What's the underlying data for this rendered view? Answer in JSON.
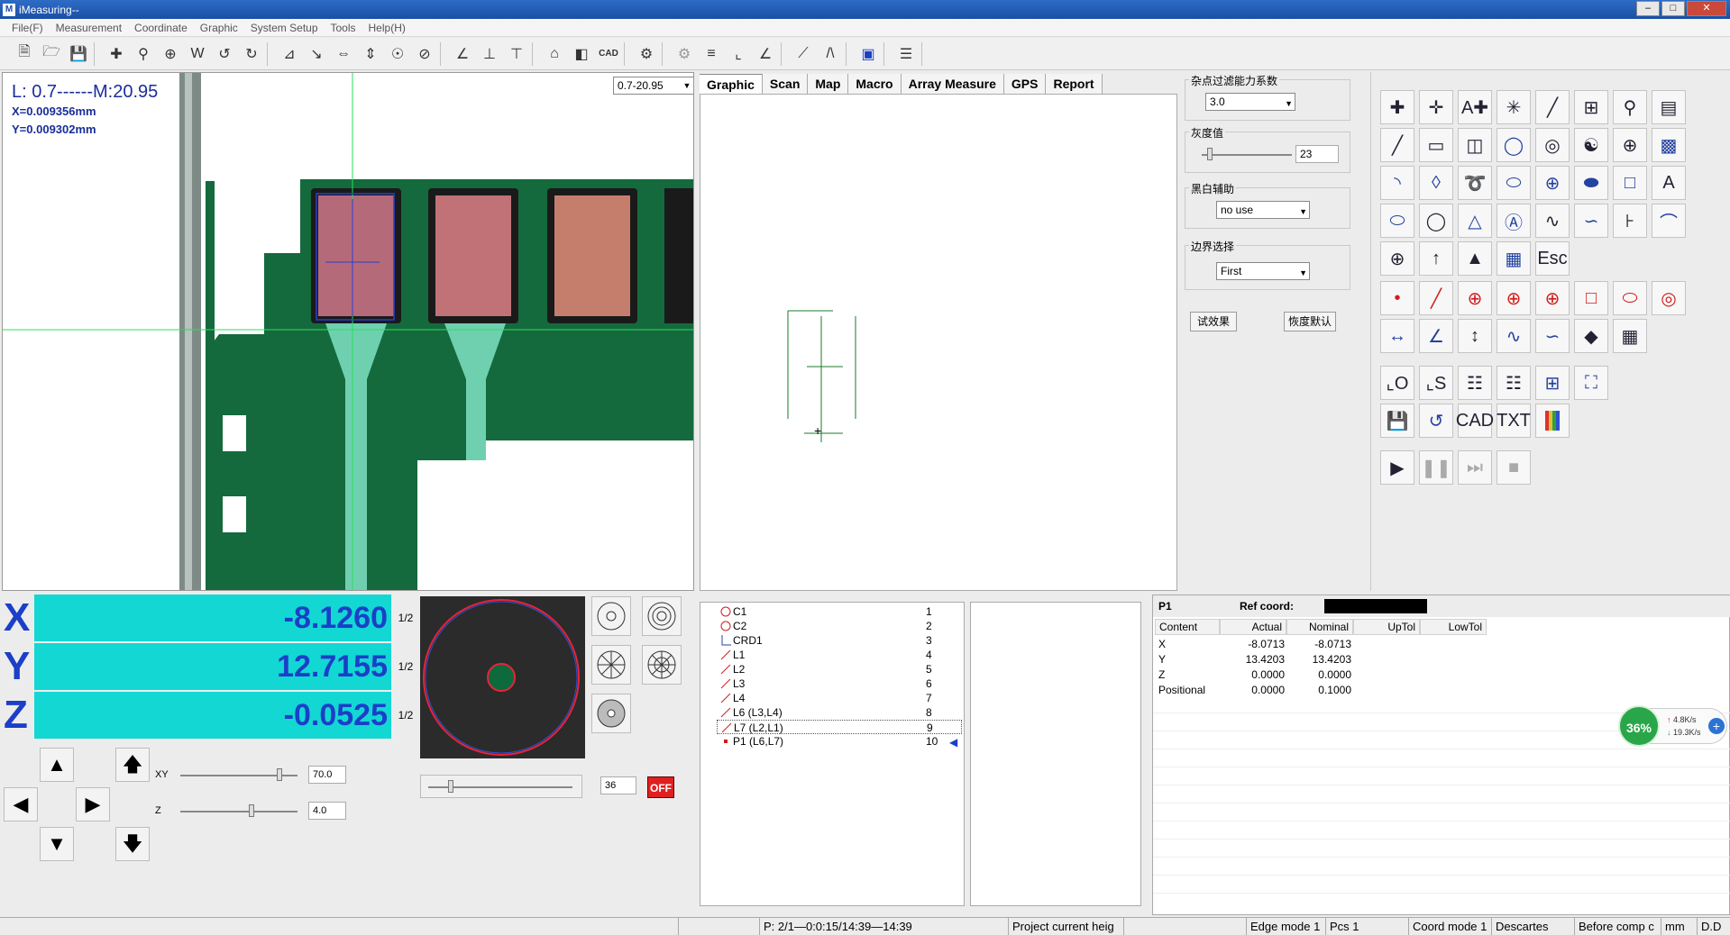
{
  "window": {
    "title": "iMeasuring--",
    "icon_label": "M",
    "controls": [
      "minimize",
      "maximize",
      "close"
    ]
  },
  "menu": [
    "File(F)",
    "Measurement",
    "Coordinate",
    "Graphic",
    "System Setup",
    "Tools",
    "Help(H)"
  ],
  "toolbar_icons": [
    "new-file-icon",
    "open-folder-icon",
    "save-icon",
    "crosshair-icon",
    "zoom-window-icon",
    "circle-cross-icon",
    "w-icon",
    "rotate-left-icon",
    "rotate-right-icon",
    "auto-a-icon",
    "measure-arrow-icon",
    "dimension-x-icon",
    "dimension-y-icon",
    "circle-measure-icon",
    "no-entry-icon",
    "angle-icon",
    "horizontal-dim-icon",
    "vertical-dim-icon",
    "home-icon",
    "region-icon",
    "cad-icon",
    "gear-icon",
    "gear-outline-icon",
    "parallel-icon",
    "perpendicular-icon",
    "angle-measure-icon",
    "line-icon",
    "parallel-lines-icon",
    "fit-screen-icon",
    "list-icon"
  ],
  "camera": {
    "magnification": "L: 0.7------M:20.95",
    "x_readout": "X=0.009356mm",
    "y_readout": "Y=0.009302mm",
    "zoom_selected": "0.7-20.95"
  },
  "graphic_tabs": [
    "Graphic",
    "Scan",
    "Map",
    "Macro",
    "Array Measure",
    "GPS",
    "Report"
  ],
  "settings": {
    "noise_label": "杂点过滤能力系数",
    "noise_value": "3.0",
    "gray_label": "灰度值",
    "gray_value": "23",
    "bw_label": "黑白辅助",
    "bw_value": "no use",
    "edge_label": "边界选择",
    "edge_value": "First",
    "test_button": "试效果",
    "restore_button": "恢度默认"
  },
  "palette_icons": [
    "cross-point-icon",
    "cross-multi-icon",
    "auto-focus-icon",
    "star-point-icon",
    "line-tool-icon",
    "add-box-icon",
    "magnify-icon",
    "image-icon",
    "slant-line-icon",
    "rect-icon",
    "double-rect-icon",
    "circle-ring-icon",
    "target-icon",
    "tri-circle-icon",
    "circle-plus-icon",
    "dotted-box-icon",
    "arc-icon",
    "lens-icon",
    "spiral-icon",
    "ellipse-icon",
    "ellipse-cross-icon",
    "slot-icon",
    "dotted-rect-icon",
    "text-a-box-icon",
    "ellipse-dotted-icon",
    "ellipse-a-icon",
    "triangle-circle-icon",
    "circle-a-icon",
    "curve-icon",
    "curve-dotted-icon",
    "ih-icon",
    "arc-blue-icon",
    "circle-plus-small-icon",
    "arrow-up-icon",
    "stamp-icon",
    "calc-table-icon",
    "esc-icon",
    "point-red-icon",
    "line-red-icon",
    "circle-red-icon",
    "circle-red-2-icon",
    "circle-red-3-icon",
    "rect-red-icon",
    "ellipse-red-icon",
    "concentric-red-icon",
    "dist-d-icon",
    "angle-a-icon",
    "height-h-icon",
    "wave-icon",
    "blob-icon",
    "eraser-icon",
    "calculator-icon",
    "origin-icon",
    "js-icon",
    "export-x-icon",
    "export-w-icon",
    "zoom-in-icon",
    "fit-icon",
    "save-disk-icon",
    "undo-icon",
    "cad-export-icon",
    "txt-export-icon",
    "color-bars-icon",
    "play-icon",
    "pause-icon",
    "step-icon",
    "stop-icon"
  ],
  "dro": {
    "axes": [
      {
        "axis": "X",
        "value": "-8.1260",
        "half": "1/2"
      },
      {
        "axis": "Y",
        "value": "12.7155",
        "half": "1/2"
      },
      {
        "axis": "Z",
        "value": "-0.0525",
        "half": "1/2"
      }
    ]
  },
  "jog": {
    "xy_label": "XY",
    "xy_speed": "70.0",
    "z_label": "Z",
    "z_speed": "4.0"
  },
  "light": {
    "level": "36",
    "off_label": "OFF"
  },
  "features": [
    {
      "name": "C1",
      "num": "1",
      "icon": "circle"
    },
    {
      "name": "C2",
      "num": "2",
      "icon": "circle"
    },
    {
      "name": "CRD1",
      "num": "3",
      "icon": "coord"
    },
    {
      "name": "L1",
      "num": "4",
      "icon": "line"
    },
    {
      "name": "L2",
      "num": "5",
      "icon": "line"
    },
    {
      "name": "L3",
      "num": "6",
      "icon": "line"
    },
    {
      "name": "L4",
      "num": "7",
      "icon": "line"
    },
    {
      "name": "L6 (L3,L4)",
      "num": "8",
      "icon": "line"
    },
    {
      "name": "L7 (L2,L1)",
      "num": "9",
      "icon": "line",
      "selected": true
    },
    {
      "name": "P1 (L6,L7)",
      "num": "10",
      "icon": "point"
    }
  ],
  "results": {
    "feature": "P1",
    "ref_label": "Ref coord:",
    "columns": [
      "Content",
      "Actual",
      "Nominal",
      "UpTol",
      "LowTol"
    ],
    "rows": [
      {
        "content": "X",
        "actual": "-8.0713",
        "nominal": "-8.0713"
      },
      {
        "content": "Y",
        "actual": "13.4203",
        "nominal": "13.4203"
      },
      {
        "content": "Z",
        "actual": "0.0000",
        "nominal": "0.0000"
      },
      {
        "content": "Positional",
        "actual": "0.0000",
        "nominal": "0.1000"
      }
    ]
  },
  "net_widget": {
    "percent": "36%",
    "up": "4.8K/s",
    "down": "19.3K/s"
  },
  "status": {
    "time": "P: 2/1—0:0:15/14:39—14:39",
    "project": "Project current heig",
    "edge": "Edge mode 1",
    "pcs": "Pcs 1",
    "coord": "Coord mode 1",
    "descartes": "Descartes",
    "comp": "Before comp c",
    "unit": "mm",
    "dd": "D.D"
  }
}
